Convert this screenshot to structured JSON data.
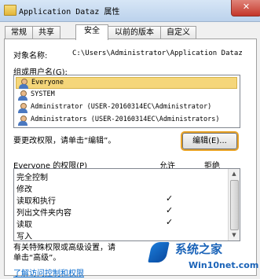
{
  "window": {
    "title": "Application Dataz 属性",
    "close_glyph": "✕"
  },
  "tabs": [
    {
      "label": "常规"
    },
    {
      "label": "共享"
    },
    {
      "label": "安全",
      "active": true
    },
    {
      "label": "以前的版本"
    },
    {
      "label": "自定义"
    }
  ],
  "object": {
    "label": "对象名称:",
    "value": "C:\\Users\\Administrator\\Application Dataz"
  },
  "groups": {
    "label": "组或用户名(G):",
    "items": [
      {
        "name": "Everyone",
        "selected": true
      },
      {
        "name": "SYSTEM",
        "selected": false
      },
      {
        "name": "Administrator (USER-20160314EC\\Administrator)",
        "selected": false
      },
      {
        "name": "Administrators (USER-20160314EC\\Administrators)",
        "selected": false
      }
    ]
  },
  "change_hint": "要更改权限，请单击“编辑”。",
  "edit_button": "编辑(E)...",
  "permissions": {
    "header_label": "Everyone 的权限(P)",
    "allow_label": "允许",
    "deny_label": "拒绝",
    "items": [
      {
        "name": "完全控制",
        "allow": false
      },
      {
        "name": "修改",
        "allow": false
      },
      {
        "name": "读取和执行",
        "allow": true
      },
      {
        "name": "列出文件夹内容",
        "allow": true
      },
      {
        "name": "读取",
        "allow": true
      },
      {
        "name": "写入",
        "allow": false
      }
    ],
    "check_glyph": "✓"
  },
  "advanced_note_line1": "有关特殊权限或高级设置，请",
  "advanced_note_line2": "单击“高级”。",
  "link_text": "了解访问控制和权限",
  "watermark": {
    "brand": "系统之家",
    "site": "Win10net.com"
  }
}
